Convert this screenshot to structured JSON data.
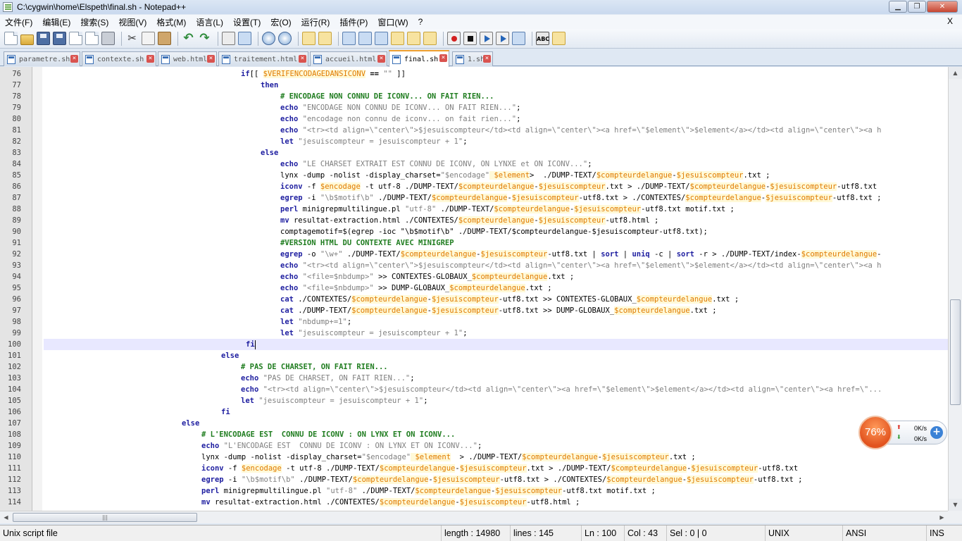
{
  "window": {
    "title": "C:\\cygwin\\home\\Elspeth\\final.sh - Notepad++"
  },
  "menu": [
    "文件(F)",
    "编辑(E)",
    "搜索(S)",
    "视图(V)",
    "格式(M)",
    "语言(L)",
    "设置(T)",
    "宏(O)",
    "运行(R)",
    "插件(P)",
    "窗口(W)",
    "?"
  ],
  "menu_close": "X",
  "toolbar": {
    "icons": [
      "new-file-icon",
      "open-file-icon",
      "save-icon",
      "save-all-icon",
      "close-icon",
      "close-all-icon",
      "print-icon",
      "cut-icon",
      "copy-icon",
      "paste-icon",
      "undo-icon",
      "redo-icon",
      "find-icon",
      "replace-icon",
      "zoom-in-icon",
      "zoom-out-icon",
      "sync-vertical-icon",
      "sync-horizontal-icon",
      "word-wrap-icon",
      "show-all-chars-icon",
      "indent-guide-icon",
      "user-defined-lang-icon",
      "doc-map-icon",
      "function-list-icon",
      "record-macro-icon",
      "stop-record-icon",
      "play-macro-icon",
      "run-macro-multiple-icon",
      "save-macro-icon",
      "spell-check-icon",
      "misc-icon"
    ],
    "spell_label": "ABC"
  },
  "tabs": [
    {
      "label": "parametre.sh",
      "active": false
    },
    {
      "label": "contexte.sh",
      "active": false
    },
    {
      "label": "web.html",
      "active": false
    },
    {
      "label": "traitement.html",
      "active": false
    },
    {
      "label": "accueil.html",
      "active": false
    },
    {
      "label": "final.sh",
      "active": true
    },
    {
      "label": "1.sh",
      "active": false
    }
  ],
  "editor": {
    "current_line": 100,
    "lines": [
      {
        "n": "76",
        "i": 40,
        "s": [
          [
            "kw",
            "if"
          ],
          [
            "",
            "[[ "
          ],
          [
            "vr",
            "$VERIFENCODAGEDANSICONV"
          ],
          [
            "op",
            " == "
          ],
          [
            "st",
            "\"\""
          ],
          [
            "",
            " ]]"
          ]
        ]
      },
      {
        "n": "77",
        "i": 44,
        "s": [
          [
            "kw",
            "then"
          ]
        ]
      },
      {
        "n": "78",
        "i": 48,
        "s": [
          [
            "cm",
            "# ENCODAGE NON CONNU DE ICONV... ON FAIT RIEN..."
          ]
        ]
      },
      {
        "n": "79",
        "i": 48,
        "s": [
          [
            "kw",
            "echo"
          ],
          [
            "st",
            " \"ENCODAGE NON CONNU DE ICONV... ON FAIT RIEN...\""
          ],
          [
            ";",
            ";"
          ]
        ]
      },
      {
        "n": "80",
        "i": 48,
        "s": [
          [
            "kw",
            "echo"
          ],
          [
            "st",
            " \"encodage non connu de iconv... on fait rien...\""
          ],
          [
            "",
            ";"
          ]
        ]
      },
      {
        "n": "81",
        "i": 48,
        "s": [
          [
            "kw",
            "echo"
          ],
          [
            "st",
            " \"<tr><td align=\\\"center\\\">$jesuiscompteur</td><td align=\\\"center\\\"><a href=\\\"$element\\\">$element</a></td><td align=\\\"center\\\"><a h"
          ]
        ]
      },
      {
        "n": "82",
        "i": 48,
        "s": [
          [
            "kw",
            "let"
          ],
          [
            "st",
            " \"jesuiscompteur = jesuiscompteur + 1\""
          ],
          [
            "",
            ";"
          ]
        ]
      },
      {
        "n": "83",
        "i": 44,
        "s": [
          [
            "kw",
            "else"
          ]
        ]
      },
      {
        "n": "84",
        "i": 48,
        "s": [
          [
            "kw",
            "echo"
          ],
          [
            "st",
            " \"LE CHARSET EXTRAIT EST CONNU DE ICONV, ON LYNXE et ON ICONV...\""
          ],
          [
            "",
            ";"
          ]
        ]
      },
      {
        "n": "85",
        "i": 48,
        "s": [
          [
            "",
            "lynx -dump -nolist -display_charset="
          ],
          [
            "st",
            "\"$encodage\""
          ],
          [
            "vr",
            " $element"
          ],
          [
            "",
            ">  ./DUMP-TEXT/"
          ],
          [
            "vr",
            "$compteurdelangue"
          ],
          [
            "",
            "-"
          ],
          [
            "vr",
            "$jesuiscompteur"
          ],
          [
            "",
            ".txt ;"
          ]
        ]
      },
      {
        "n": "86",
        "i": 48,
        "s": [
          [
            "kw",
            "iconv"
          ],
          [
            "",
            " -f "
          ],
          [
            "vr",
            "$encodage"
          ],
          [
            "",
            " -t utf-8 ./DUMP-TEXT/"
          ],
          [
            "vr",
            "$compteurdelangue"
          ],
          [
            "",
            "-"
          ],
          [
            "vr",
            "$jesuiscompteur"
          ],
          [
            "",
            ".txt > ./DUMP-TEXT/"
          ],
          [
            "vr",
            "$compteurdelangue"
          ],
          [
            "",
            "-"
          ],
          [
            "vr",
            "$jesuiscompteur"
          ],
          [
            "",
            "-utf8.txt"
          ]
        ]
      },
      {
        "n": "87",
        "i": 48,
        "s": [
          [
            "kw",
            "egrep"
          ],
          [
            "",
            " -i "
          ],
          [
            "st",
            "\"\\b$motif\\b\""
          ],
          [
            "",
            " ./DUMP-TEXT/"
          ],
          [
            "vr",
            "$compteurdelangue"
          ],
          [
            "",
            "-"
          ],
          [
            "vr",
            "$jesuiscompteur"
          ],
          [
            "",
            "-utf8.txt > ./CONTEXTES/"
          ],
          [
            "vr",
            "$compteurdelangue"
          ],
          [
            "",
            "-"
          ],
          [
            "vr",
            "$jesuiscompteur"
          ],
          [
            "",
            "-utf8.txt ;"
          ]
        ]
      },
      {
        "n": "88",
        "i": 48,
        "s": [
          [
            "kw",
            "perl"
          ],
          [
            "",
            " minigrepmultilingue.pl "
          ],
          [
            "st",
            "\"utf-8\""
          ],
          [
            "",
            " ./DUMP-TEXT/"
          ],
          [
            "vr",
            "$compteurdelangue"
          ],
          [
            "",
            "-"
          ],
          [
            "vr",
            "$jesuiscompteur"
          ],
          [
            "",
            "-utf8.txt motif.txt ;"
          ]
        ]
      },
      {
        "n": "89",
        "i": 48,
        "s": [
          [
            "kw",
            "mv"
          ],
          [
            "",
            " resultat-extraction.html ./CONTEXTES/"
          ],
          [
            "vr",
            "$compteurdelangue"
          ],
          [
            "",
            "-"
          ],
          [
            "vr",
            "$jesuiscompteur"
          ],
          [
            "",
            "-utf8.html ;"
          ]
        ]
      },
      {
        "n": "90",
        "i": 48,
        "s": [
          [
            "",
            "comptagemotif=$(egrep -ioc \"\\b$motif\\b\" ./DUMP-TEXT/$compteurdelangue-$jesuiscompteur-utf8.txt);"
          ]
        ]
      },
      {
        "n": "91",
        "i": 48,
        "s": [
          [
            "cm",
            "#VERSION HTML DU CONTEXTE AVEC MINIGREP"
          ]
        ]
      },
      {
        "n": "92",
        "i": 48,
        "s": [
          [
            "kw",
            "egrep"
          ],
          [
            "",
            " -o "
          ],
          [
            "st",
            "\"\\w+\""
          ],
          [
            "",
            " ./DUMP-TEXT/"
          ],
          [
            "vr",
            "$compteurdelangue"
          ],
          [
            "",
            "-"
          ],
          [
            "vr",
            "$jesuiscompteur"
          ],
          [
            "",
            "-utf8.txt | "
          ],
          [
            "kw",
            "sort"
          ],
          [
            "",
            " | "
          ],
          [
            "kw",
            "uniq"
          ],
          [
            "",
            " -c | "
          ],
          [
            "kw",
            "sort"
          ],
          [
            "",
            " -r > ./DUMP-TEXT/index-"
          ],
          [
            "vr",
            "$compteurdelangue"
          ],
          [
            "",
            "-"
          ]
        ]
      },
      {
        "n": "93",
        "i": 48,
        "s": [
          [
            "kw",
            "echo"
          ],
          [
            "st",
            " \"<tr><td align=\\\"center\\\">$jesuiscompteur</td><td align=\\\"center\\\"><a href=\\\"$element\\\">$element</a></td><td align=\\\"center\\\"><a h"
          ]
        ]
      },
      {
        "n": "94",
        "i": 48,
        "s": [
          [
            "kw",
            "echo"
          ],
          [
            "st",
            " \"<file=$nbdump>\""
          ],
          [
            "",
            " >> CONTEXTES-GLOBAUX_"
          ],
          [
            "vr",
            "$compteurdelangue"
          ],
          [
            "",
            ".txt ;"
          ]
        ]
      },
      {
        "n": "95",
        "i": 48,
        "s": [
          [
            "kw",
            "echo"
          ],
          [
            "st",
            " \"<file=$nbdump>\""
          ],
          [
            "",
            " >> DUMP-GLOBAUX_"
          ],
          [
            "vr",
            "$compteurdelangue"
          ],
          [
            "",
            ".txt ;"
          ]
        ]
      },
      {
        "n": "96",
        "i": 48,
        "s": [
          [
            "kw",
            "cat"
          ],
          [
            "",
            " ./CONTEXTES/"
          ],
          [
            "vr",
            "$compteurdelangue"
          ],
          [
            "",
            "-"
          ],
          [
            "vr",
            "$jesuiscompteur"
          ],
          [
            "",
            "-utf8.txt >> CONTEXTES-GLOBAUX_"
          ],
          [
            "vr",
            "$compteurdelangue"
          ],
          [
            "",
            ".txt ;"
          ]
        ]
      },
      {
        "n": "97",
        "i": 48,
        "s": [
          [
            "kw",
            "cat"
          ],
          [
            "",
            " ./DUMP-TEXT/"
          ],
          [
            "vr",
            "$compteurdelangue"
          ],
          [
            "",
            "-"
          ],
          [
            "vr",
            "$jesuiscompteur"
          ],
          [
            "",
            "-utf8.txt >> DUMP-GLOBAUX_"
          ],
          [
            "vr",
            "$compteurdelangue"
          ],
          [
            "",
            ".txt ;"
          ]
        ]
      },
      {
        "n": "98",
        "i": 48,
        "s": [
          [
            "kw",
            "let"
          ],
          [
            "st",
            " \"nbdump+=1\""
          ],
          [
            "",
            ";"
          ]
        ]
      },
      {
        "n": "99",
        "i": 48,
        "s": [
          [
            "kw",
            "let"
          ],
          [
            "st",
            " \"jesuiscompteur = jesuiscompteur + 1\""
          ],
          [
            "",
            ";"
          ]
        ]
      },
      {
        "n": "100",
        "i": 41,
        "s": [
          [
            "kw",
            "fi"
          ]
        ],
        "cur": true
      },
      {
        "n": "101",
        "i": 36,
        "s": [
          [
            "kw",
            "else"
          ]
        ]
      },
      {
        "n": "102",
        "i": 40,
        "s": [
          [
            "cm",
            "# PAS DE CHARSET, ON FAIT RIEN..."
          ]
        ]
      },
      {
        "n": "103",
        "i": 40,
        "s": [
          [
            "kw",
            "echo"
          ],
          [
            "st",
            " \"PAS DE CHARSET, ON FAIT RIEN...\""
          ],
          [
            "",
            ";"
          ]
        ]
      },
      {
        "n": "104",
        "i": 40,
        "s": [
          [
            "kw",
            "echo"
          ],
          [
            "st",
            " \"<tr><td align=\\\"center\\\">$jesuiscompteur</td><td align=\\\"center\\\"><a href=\\\"$element\\\">$element</a></td><td align=\\\"center\\\"><a href=\\\"..."
          ]
        ]
      },
      {
        "n": "105",
        "i": 40,
        "s": [
          [
            "kw",
            "let"
          ],
          [
            "st",
            " \"jesuiscompteur = jesuiscompteur + 1\""
          ],
          [
            "",
            ";"
          ]
        ]
      },
      {
        "n": "106",
        "i": 36,
        "s": [
          [
            "kw",
            "fi"
          ]
        ]
      },
      {
        "n": "107",
        "i": 28,
        "s": [
          [
            "kw",
            "else"
          ]
        ]
      },
      {
        "n": "108",
        "i": 32,
        "s": [
          [
            "cm",
            "# L'ENCODAGE EST  CONNU DE ICONV : ON LYNX ET ON ICONV..."
          ]
        ]
      },
      {
        "n": "109",
        "i": 32,
        "s": [
          [
            "kw",
            "echo"
          ],
          [
            "st",
            " \"L'ENCODAGE EST  CONNU DE ICONV : ON LYNX ET ON ICONV...\""
          ],
          [
            "",
            ";"
          ]
        ]
      },
      {
        "n": "110",
        "i": 32,
        "s": [
          [
            "",
            "lynx -dump -nolist -display_charset="
          ],
          [
            "st",
            "\"$encodage\""
          ],
          [
            "vr",
            " $element"
          ],
          [
            "",
            "  > ./DUMP-TEXT/"
          ],
          [
            "vr",
            "$compteurdelangue"
          ],
          [
            "",
            "-"
          ],
          [
            "vr",
            "$jesuiscompteur"
          ],
          [
            "",
            ".txt ;"
          ]
        ]
      },
      {
        "n": "111",
        "i": 32,
        "s": [
          [
            "kw",
            "iconv"
          ],
          [
            "",
            " -f "
          ],
          [
            "vr",
            "$encodage"
          ],
          [
            "",
            " -t utf-8 ./DUMP-TEXT/"
          ],
          [
            "vr",
            "$compteurdelangue"
          ],
          [
            "",
            "-"
          ],
          [
            "vr",
            "$jesuiscompteur"
          ],
          [
            "",
            ".txt > ./DUMP-TEXT/"
          ],
          [
            "vr",
            "$compteurdelangue"
          ],
          [
            "",
            "-"
          ],
          [
            "vr",
            "$jesuiscompteur"
          ],
          [
            "",
            "-utf8.txt"
          ]
        ]
      },
      {
        "n": "112",
        "i": 32,
        "s": [
          [
            "kw",
            "egrep"
          ],
          [
            "",
            " -i "
          ],
          [
            "st",
            "\"\\b$motif\\b\""
          ],
          [
            "",
            " ./DUMP-TEXT/"
          ],
          [
            "vr",
            "$compteurdelangue"
          ],
          [
            "",
            "-"
          ],
          [
            "vr",
            "$jesuiscompteur"
          ],
          [
            "",
            "-utf8.txt > ./CONTEXTES/"
          ],
          [
            "vr",
            "$compteurdelangue"
          ],
          [
            "",
            "-"
          ],
          [
            "vr",
            "$jesuiscompteur"
          ],
          [
            "",
            "-utf8.txt ;"
          ]
        ]
      },
      {
        "n": "113",
        "i": 32,
        "s": [
          [
            "kw",
            "perl"
          ],
          [
            "",
            " minigrepmultilingue.pl "
          ],
          [
            "st",
            "\"utf-8\""
          ],
          [
            "",
            " ./DUMP-TEXT/"
          ],
          [
            "vr",
            "$compteurdelangue"
          ],
          [
            "",
            "-"
          ],
          [
            "vr",
            "$jesuiscompteur"
          ],
          [
            "",
            "-utf8.txt motif.txt ;"
          ]
        ]
      },
      {
        "n": "114",
        "i": 32,
        "s": [
          [
            "kw",
            "mv"
          ],
          [
            "",
            " resultat-extraction.html ./CONTEXTES/"
          ],
          [
            "vr",
            "$compteurdelangue"
          ],
          [
            "",
            "-"
          ],
          [
            "vr",
            "$jesuiscompteur"
          ],
          [
            "",
            "-utf8.html ;"
          ]
        ]
      }
    ]
  },
  "status": {
    "file_type": "Unix script file",
    "length": "length : 14980",
    "lines": "lines : 145",
    "ln": "Ln : 100",
    "col": "Col : 43",
    "sel": "Sel : 0 | 0",
    "eol": "UNIX",
    "encoding": "ANSI",
    "mode": "INS"
  },
  "net_widget": {
    "percent": "76%",
    "up_rate": "0K/s",
    "down_rate": "0K/s",
    "up_icon": "upload-arrow-icon",
    "down_icon": "download-arrow-icon",
    "plus_icon": "plus-icon"
  },
  "scroll": {
    "h_thumb_grip": "|||"
  }
}
